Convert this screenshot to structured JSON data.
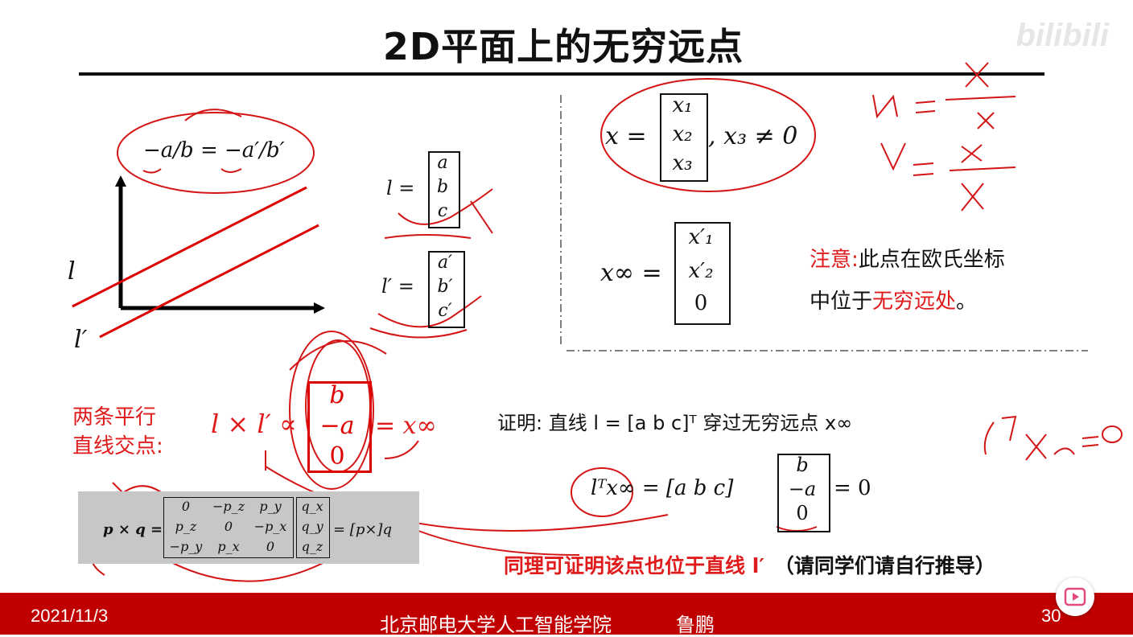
{
  "slide": {
    "title": "2D平面上的无穷远点",
    "watermark": "bilibili",
    "slope_eq": "−a/b = −a′/b′",
    "line_label_l": "l",
    "line_label_lp": "l′",
    "l_vec": {
      "lhs": "l =",
      "entries": [
        "a",
        "b",
        "c"
      ]
    },
    "lp_vec": {
      "lhs": "l′ =",
      "entries": [
        "a′",
        "b′",
        "c′"
      ]
    },
    "x_vec": {
      "lhs": "x =",
      "entries": [
        "x₁",
        "x₂",
        "x₃"
      ],
      "tail": ", x₃ ≠ 0"
    },
    "xinf_vec": {
      "lhs": "x∞ =",
      "entries": [
        "x′₁",
        "x′₂",
        "0"
      ]
    },
    "note_label": "注意:",
    "note_line1": "此点在欧氏坐标",
    "note_line2_pre": "中位于",
    "note_line2_red": "无穷远处",
    "note_line2_post": "。",
    "intersect_label_1": "两条平行",
    "intersect_label_2": "直线交点:",
    "cross_lhs": "l × l′ ∝",
    "cross_entries": [
      "b",
      "−a",
      "0"
    ],
    "cross_rhs": "= x∞",
    "proof_line": "证明:  直线  l = [a b c]ᵀ  穿过无穷远点  x∞",
    "proof_eq_lhs": "lᵀx∞ = [a    b    c]",
    "proof_eq_vec": [
      "b",
      "−a",
      "0"
    ],
    "proof_eq_rhs": "= 0",
    "same_proof_red": "同理可证明该点也位于直线 l′",
    "same_proof_black": "（请同学们请自行推导）",
    "cross_product_box": {
      "lhs": "p × q =",
      "matrix": [
        [
          "0",
          "−p_z",
          "p_y"
        ],
        [
          "p_z",
          "0",
          "−p_x"
        ],
        [
          "−p_y",
          "p_x",
          "0"
        ]
      ],
      "qvec": [
        "q_x",
        "q_y",
        "q_z"
      ],
      "rhs": "= [p×]q"
    },
    "handwriting": {
      "u_eq": "U = x₁ / x₃",
      "v_eq": "V = x₂ / x₃",
      "lt_eq": "lᵀx∞=0"
    }
  },
  "footer": {
    "date": "2021/11/3",
    "institution": "北京邮电大学人工智能学院",
    "author": "鲁鹏",
    "page": "30"
  },
  "colors": {
    "accent_red": "#e01b1b",
    "footer_bg": "#c00000",
    "ink_red": "#d41515"
  }
}
